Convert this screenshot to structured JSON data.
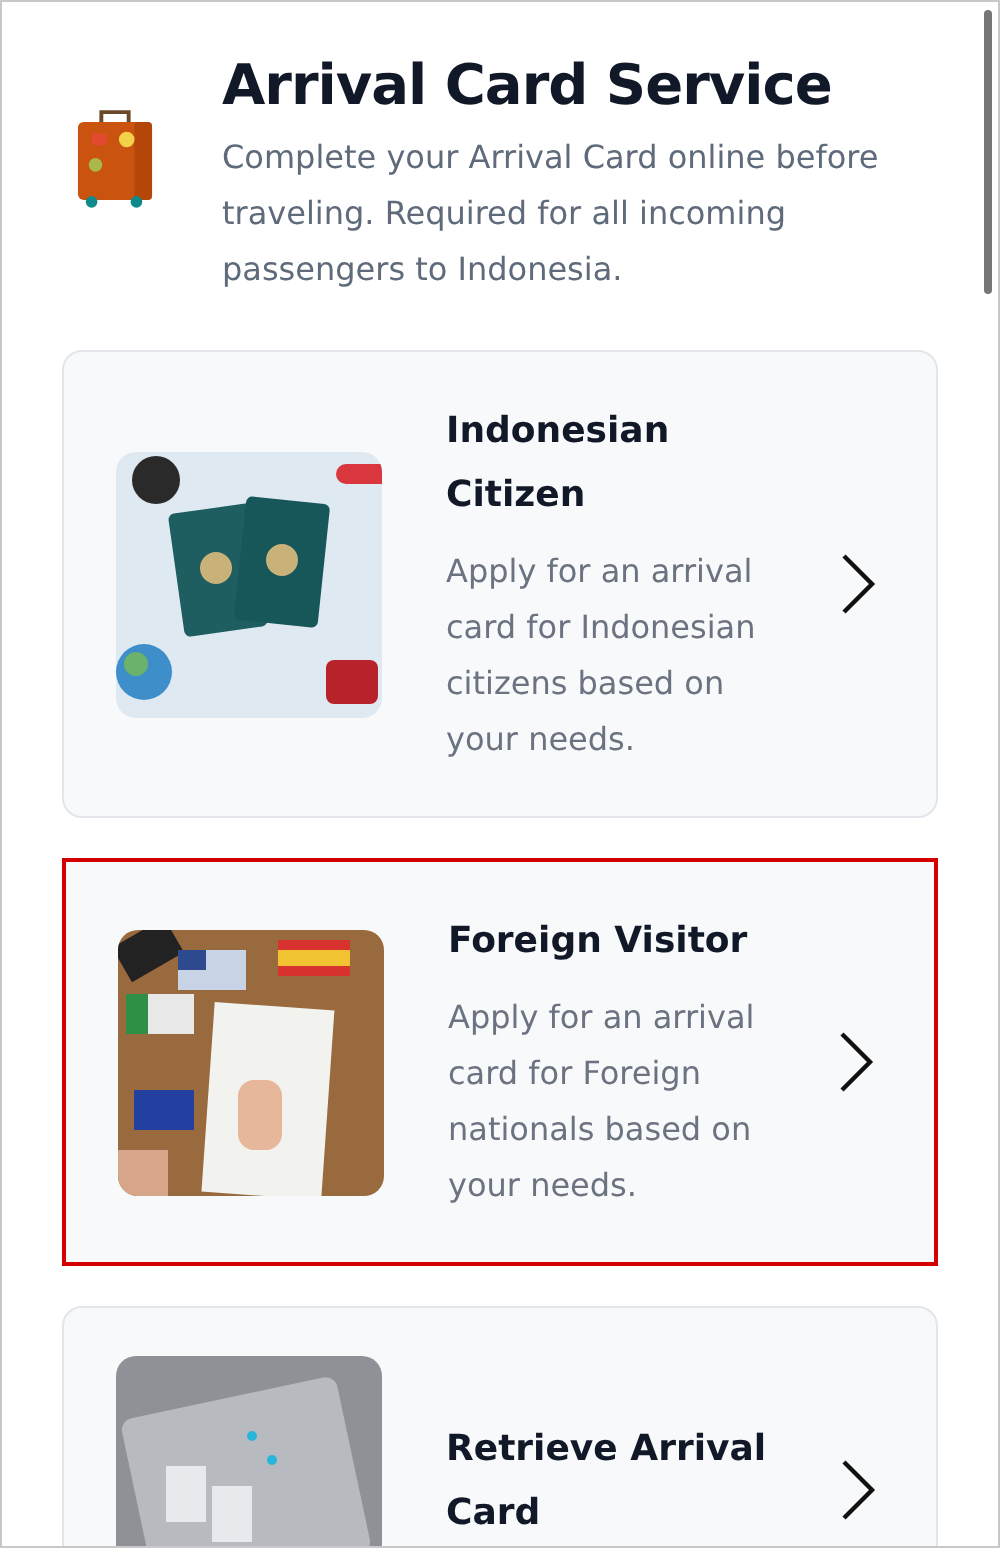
{
  "header": {
    "title": "Arrival Card Service",
    "subtitle": "Complete your Arrival Card online before traveling. Required for all incoming passengers to Indonesia."
  },
  "cards": [
    {
      "kind": "passport",
      "title": "Indonesian Citizen",
      "description": "Apply for an arrival card for Indonesian citizens based on your needs.",
      "selected": false
    },
    {
      "kind": "flags",
      "title": "Foreign Visitor",
      "description": "Apply for an arrival card for Foreign nationals based on your needs.",
      "selected": true
    },
    {
      "kind": "documents",
      "title": "Retrieve Arrival Card",
      "selected": false
    }
  ]
}
